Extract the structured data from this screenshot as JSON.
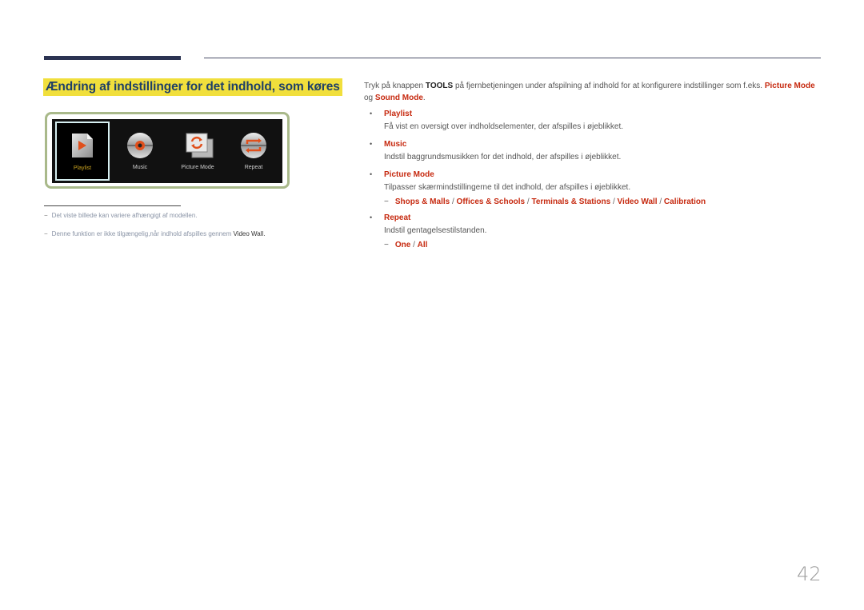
{
  "section": {
    "title": "Ændring af indstillinger for det indhold, som køres"
  },
  "menu": {
    "items": [
      {
        "label": "Playlist",
        "icon": "playlist-file-icon",
        "selected": true
      },
      {
        "label": "Music",
        "icon": "music-disc-icon",
        "selected": false
      },
      {
        "label": "Picture Mode",
        "icon": "picture-mode-icon",
        "selected": false
      },
      {
        "label": "Repeat",
        "icon": "repeat-icon",
        "selected": false
      }
    ],
    "colors": {
      "frame": "#a9b98a",
      "panel": "#111111",
      "selected_label": "#c9a21f",
      "accent_icon": "#e0501c"
    }
  },
  "footnotes": [
    {
      "text": "Det viste billede kan variere afhængigt af modellen."
    },
    {
      "text": "Denne funktion er ikke tilgængelig,når indhold afspilles gennem ",
      "strong": "Video Wall",
      "end": "."
    }
  ],
  "intro": {
    "part1": "Tryk på knappen ",
    "tools": "TOOLS",
    "part2": " på fjernbetjeningen under afspilning af indhold for at konfigurere indstillinger som f.eks. ",
    "link1": "Picture Mode",
    "and": " og ",
    "link2": "Sound Mode",
    "end": "."
  },
  "options": [
    {
      "title": "Playlist",
      "desc": "Få vist en oversigt over indholdselementer, der afspilles i øjeblikket."
    },
    {
      "title": "Music",
      "desc": "Indstil baggrundsmusikken for det indhold, der afspilles i øjeblikket."
    },
    {
      "title": "Picture Mode",
      "desc": "Tilpasser skærmindstillingerne til det indhold, der afspilles i øjeblikket.",
      "sub": [
        "Shops & Malls",
        "Offices & Schools",
        "Terminals & Stations",
        "Video Wall",
        "Calibration"
      ]
    },
    {
      "title": "Repeat",
      "desc": "Indstil gentagelsestilstanden.",
      "sub": [
        "One",
        "All"
      ]
    }
  ],
  "separator": " / ",
  "dash": "−",
  "bullet": "•",
  "page_number": "42",
  "colors": {
    "accent_red": "#c6290f",
    "highlight": "#f1df3c",
    "title_text": "#1e3f67",
    "rule": "#2b3352"
  }
}
